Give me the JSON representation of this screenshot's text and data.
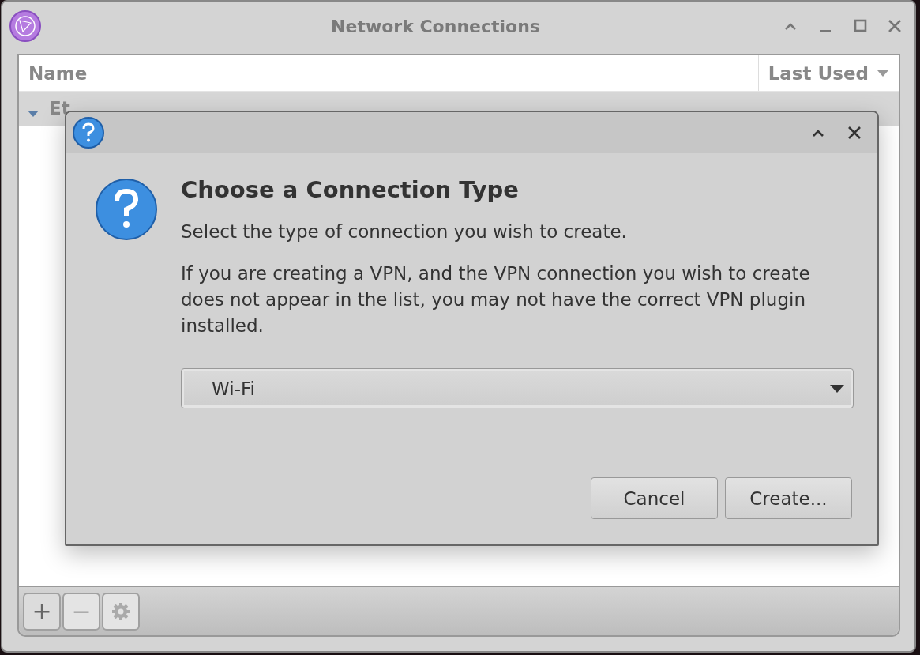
{
  "window": {
    "title": "Network Connections"
  },
  "table": {
    "columns": [
      {
        "label": "Name",
        "sorted": false
      },
      {
        "label": "Last Used",
        "sorted": true
      }
    ],
    "groups": [
      {
        "label": "Et",
        "expanded": true
      }
    ]
  },
  "toolbar": [
    {
      "kind": "add",
      "label": "+",
      "disabled": false
    },
    {
      "kind": "remove",
      "label": "−",
      "disabled": true
    },
    {
      "kind": "settings",
      "disabled": true
    }
  ],
  "dialog": {
    "heading": "Choose a Connection Type",
    "paragraphs": [
      "Select the type of connection you wish to create.",
      "If you are creating a VPN, and the VPN connection you wish to create does not appear in the list, you may not have the correct VPN plugin installed."
    ],
    "dropdown": {
      "value": "Wi-Fi"
    },
    "buttons": [
      "Cancel",
      "Create..."
    ]
  }
}
